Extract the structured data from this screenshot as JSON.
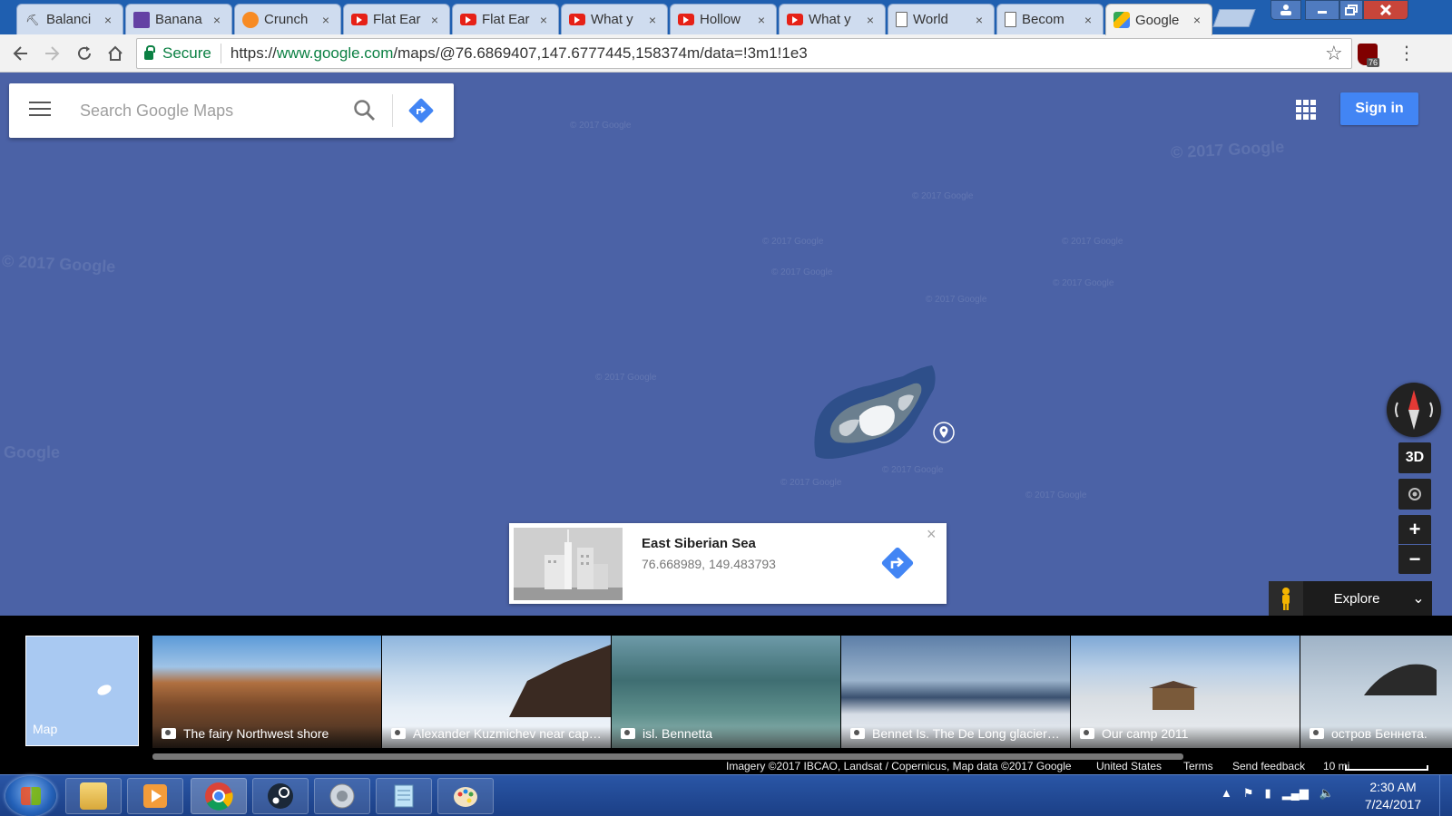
{
  "tabs": [
    {
      "title": "Balanci",
      "icon": "pickaxe-icon",
      "active": false
    },
    {
      "title": "Banana",
      "icon": "twitch-icon",
      "active": false
    },
    {
      "title": "Crunch",
      "icon": "crunchyroll-icon",
      "active": false
    },
    {
      "title": "Flat Ear",
      "icon": "youtube-icon",
      "active": false
    },
    {
      "title": "Flat Ear",
      "icon": "youtube-icon",
      "active": false
    },
    {
      "title": "What y",
      "icon": "youtube-icon",
      "active": false
    },
    {
      "title": "Hollow",
      "icon": "youtube-icon",
      "active": false
    },
    {
      "title": "What y",
      "icon": "youtube-icon",
      "active": false
    },
    {
      "title": "World",
      "icon": "document-icon",
      "active": false
    },
    {
      "title": "Becom",
      "icon": "document-icon",
      "active": false
    },
    {
      "title": "Google",
      "icon": "google-maps-icon",
      "active": true
    }
  ],
  "tab_close_glyph": "×",
  "address_bar": {
    "secure_label": "Secure",
    "url_scheme": "https://",
    "url_host": "www.google.com",
    "url_path": "/maps/@76.6869407,147.6777445,158374m/data=!3m1!1e3",
    "extension_badge": "76"
  },
  "maps": {
    "search_placeholder": "Search Google Maps",
    "sign_in_label": "Sign in",
    "watermark": "© 2017 Google",
    "watermark_short": "Google",
    "info_card": {
      "title": "East Siberian Sea",
      "coordinates": "76.668989, 149.483793",
      "close_glyph": "×"
    },
    "controls": {
      "three_d_label": "3D",
      "zoom_in": "+",
      "zoom_out": "−",
      "explore_label": "Explore"
    }
  },
  "photo_strip": {
    "map_label": "Map",
    "photos": [
      {
        "caption": "The fairy Northwest shore"
      },
      {
        "caption": "Alexander Kuzmichev near cape ..."
      },
      {
        "caption": "isl. Bennetta"
      },
      {
        "caption": "Bennet Is. The De Long glacier is..."
      },
      {
        "caption": "Our camp 2011"
      },
      {
        "caption": "остров Беннета."
      }
    ]
  },
  "attribution": {
    "imagery": "Imagery ©2017 IBCAO, Landsat / Copernicus, Map data ©2017 Google",
    "region": "United States",
    "terms": "Terms",
    "feedback": "Send feedback",
    "scale": "10 mi"
  },
  "taskbar": {
    "apps": [
      "explorer-icon",
      "media-player-icon",
      "chrome-icon",
      "steam-icon",
      "speaker-app-icon",
      "notepad-icon",
      "paint-icon"
    ],
    "time": "2:30 AM",
    "date": "7/24/2017"
  },
  "colors": {
    "map_ocean": "#4b62a6",
    "accent_blue": "#4285f4",
    "secure_green": "#0b8043",
    "taskbar": "#1f4a96"
  }
}
